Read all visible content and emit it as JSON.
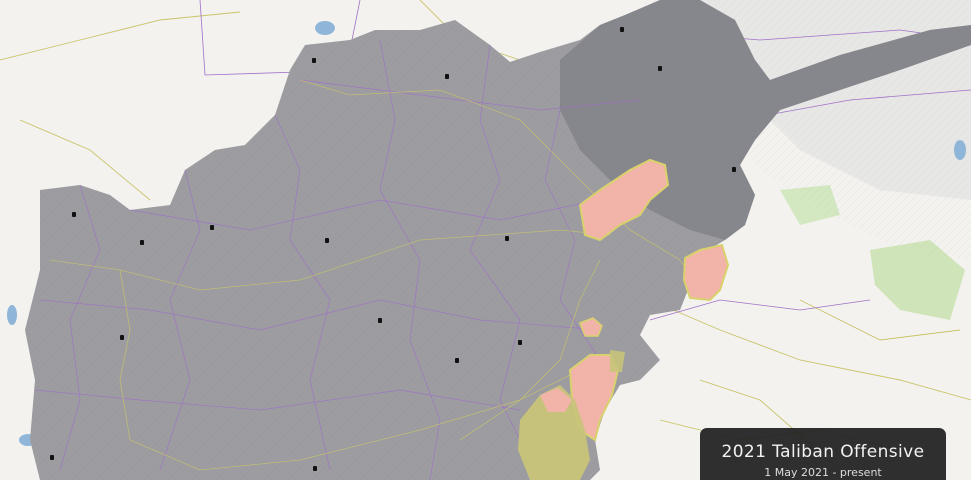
{
  "map": {
    "legend": {
      "title": "2021 Taliban Offensive",
      "subtitle": "1 May 2021 - present"
    },
    "colors": {
      "land": "#f3f2ee",
      "taliban_controlled": "#9c9ca1",
      "taliban_controlled_dark": "#7d7d85",
      "government_controlled": "#f2b3a8",
      "contested": "#c8c47a",
      "roads": "#c9c46b",
      "borders": "#a070c8",
      "water": "#8fb6d8",
      "vegetation": "#7fc24a",
      "legend_bg": "#1e1e20"
    },
    "legend_position": "bottom-right"
  }
}
